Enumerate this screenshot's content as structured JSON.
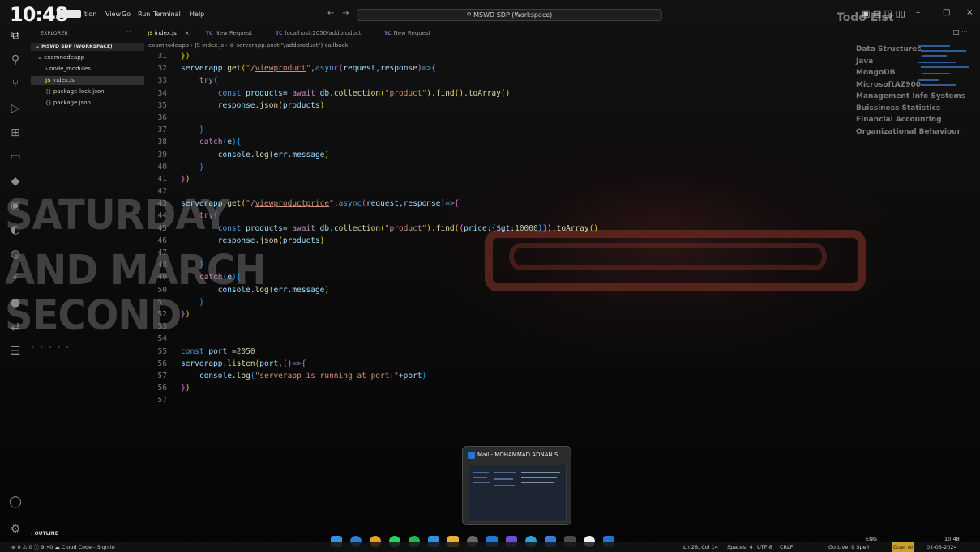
{
  "titlebar": {
    "clock": "10:48",
    "menu": [
      "tion",
      "View",
      "Go",
      "Run",
      "Terminal",
      "Help"
    ],
    "nav_back": "←",
    "nav_fwd": "→",
    "command_center": "MSWD SDP (Workspace)",
    "window_controls": [
      "–",
      "□",
      "×"
    ]
  },
  "wallpaper": {
    "day": "SATURDAY",
    "line2": "AND MARCH",
    "line3": "SECOND"
  },
  "explorer": {
    "header": "EXPLORER",
    "more": "···",
    "workspace": "MSWD SDP (WORKSPACE)",
    "items": [
      {
        "label": "examnodeapp",
        "prefix": "⌄"
      },
      {
        "label": "node_modules",
        "prefix": "›"
      },
      {
        "label": "index.js",
        "badge": "JS"
      },
      {
        "label": "package-lock.json",
        "badge": "{}"
      },
      {
        "label": "package.json",
        "badge": "{}"
      }
    ],
    "outline": "OUTLINE"
  },
  "tabs": [
    {
      "badge": "JS",
      "label": "index.js",
      "close": "×"
    },
    {
      "badge": "TC",
      "label": "New Request"
    },
    {
      "badge": "TC",
      "label": "localhost:2050/addproduct"
    },
    {
      "badge": "TC",
      "label": "New Request"
    }
  ],
  "breadcrumb": "examnodeapp  ›  JS index.js  ›  ⊕ serverapp.post(\"/addproduct\") callback",
  "editor_actions": "◫ ···",
  "code_lines": [
    "31",
    "32",
    "33",
    "34",
    "35",
    "36",
    "37",
    "38",
    "39",
    "40",
    "41",
    "42",
    "43",
    "44",
    "45",
    "46",
    "47",
    "48",
    "49",
    "50",
    "51",
    "52",
    "53",
    "54",
    "55",
    "56",
    "57"
  ],
  "todo": {
    "title": "Todo List",
    "items": [
      "Data Structures",
      "Java",
      "MongoDB",
      "MicrosoftAZ900",
      "Management Info Systems",
      "Buissiness Statistics",
      "Financial Accounting",
      "Organizational Behaviour"
    ]
  },
  "mail_preview": {
    "title": "Mail - MOHAMMAD ADNAN S..."
  },
  "status": {
    "left": "⊗ 0 ⚠ 0 ⓘ 9   ⚡0   ☁ Cloud Code - Sign in",
    "position": "Ln 28, Col 14",
    "spaces": "Spaces: 4",
    "encoding": "UTF-8",
    "eol": "CRLF",
    "golive": "Go Live",
    "spell": "9 Spell",
    "duet": "Duet AI",
    "lang": "ENG",
    "time": "10:48",
    "date": "02-03-2024"
  },
  "colors": {
    "keyword": "#569cd6",
    "function": "#dcdcaa",
    "string": "#ce9178",
    "variable": "#9cdcfe",
    "number": "#b5cea8"
  }
}
